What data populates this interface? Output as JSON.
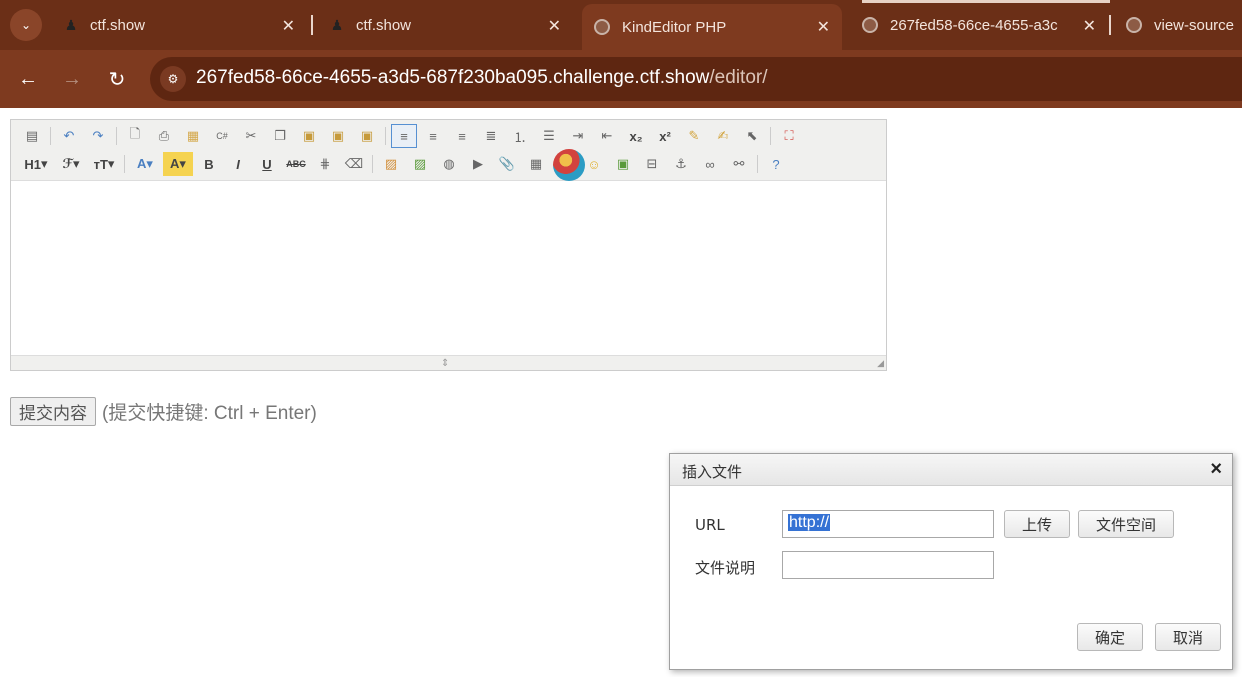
{
  "browser": {
    "tabs": [
      {
        "title": "ctf.show",
        "favicon": "runner-icon"
      },
      {
        "title": "ctf.show",
        "favicon": "runner-icon"
      },
      {
        "title": "KindEditor PHP",
        "favicon": "globe-icon",
        "active": true
      },
      {
        "title": "267fed58-66ce-4655-a3c",
        "favicon": "globe-icon"
      },
      {
        "title": "view-source",
        "favicon": "globe-icon"
      }
    ],
    "url_host": "267fed58-66ce-4655-a3d5-687f230ba095.challenge.ctf.show",
    "url_path": "/editor/",
    "theme_color": "#7e3a1f"
  },
  "editor": {
    "toolbar_row1": [
      "source",
      "undo",
      "redo",
      "preview",
      "print",
      "template",
      "code",
      "cut",
      "copy",
      "paste",
      "plainpaste",
      "wordpaste",
      "justifyleft",
      "justifycenter",
      "justifyright",
      "justifyfull",
      "insertorderedlist",
      "insertunorderedlist",
      "indent",
      "outdent",
      "subscript",
      "superscript",
      "clearhtml",
      "quickformat",
      "selectall",
      "fullscreen"
    ],
    "toolbar_row2": [
      "formatblock",
      "fontname",
      "fontsize",
      "forecolor",
      "hilitecolor",
      "bold",
      "italic",
      "underline",
      "strikethrough",
      "lineheight",
      "removeformat",
      "image",
      "multiimage",
      "flash",
      "media",
      "insertfile",
      "table",
      "hr",
      "emoticons",
      "baidumap",
      "pagebreak",
      "anchor",
      "link",
      "unlink",
      "about"
    ],
    "labels": {
      "h1": "H1",
      "fontname": "ℱ",
      "fontsize": "тT",
      "bold": "B",
      "italic": "I",
      "underline": "U",
      "strike": "ABC",
      "subscript": "x₂",
      "superscript": "x²"
    },
    "content": ""
  },
  "form": {
    "submit_label": "提交内容",
    "hint": "(提交快捷键: Ctrl + Enter)"
  },
  "dialog": {
    "title": "插入文件",
    "url_label": "URL",
    "url_value": "http://",
    "desc_label": "文件说明",
    "desc_value": "",
    "upload_label": "上传",
    "filespace_label": "文件空间",
    "ok_label": "确定",
    "cancel_label": "取消"
  }
}
